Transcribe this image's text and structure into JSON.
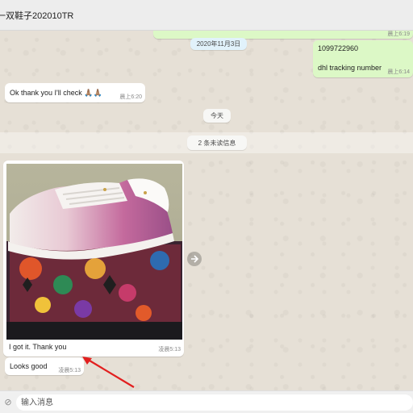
{
  "header": {
    "title": "一双鞋子202010TR"
  },
  "chat": {
    "top_outgoing_time": "晨上6:19",
    "date_pill": "2020年11月3日",
    "tracking_bubble": {
      "number": "1099722960",
      "caption": "dhl tracking number",
      "time": "晨上6:14"
    },
    "reply_bubble": {
      "text": "Ok thank you I'll check 🙏🏽🙏🏽",
      "time": "晨上6:20"
    },
    "today_pill": "今天",
    "unread_pill": "2 条未读信息",
    "photo_bubble": {
      "caption": "I got it. Thank you",
      "time": "凌晨5:13"
    },
    "looks_good_bubble": {
      "text": "Looks good",
      "time": "凌晨5:13"
    }
  },
  "input": {
    "placeholder": "输入消息",
    "attach_icon": "paperclip-icon"
  },
  "colors": {
    "outgoing": "#dcf8c6",
    "incoming": "#ffffff",
    "arrow": "#e21f1f",
    "background": "#e6e0d6"
  }
}
